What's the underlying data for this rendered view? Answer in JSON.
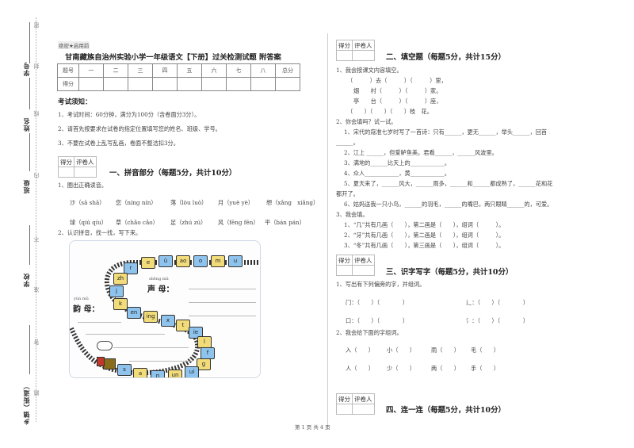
{
  "margin": {
    "labels": [
      "学号",
      "姓名",
      "班级",
      "学校",
      "乡镇（街道）"
    ],
    "seal_chars": [
      "密",
      "封",
      "线",
      "内",
      "不",
      "准",
      "答",
      "题"
    ]
  },
  "header": {
    "secret_tag": "绝密★启用前",
    "title": "甘南藏族自治州实验小学一年级语文【下册】过关检测试题 附答案",
    "score_table": {
      "row1": [
        "题号",
        "一",
        "二",
        "三",
        "四",
        "五",
        "六",
        "七",
        "八",
        "总分"
      ],
      "row2_label": "得分"
    }
  },
  "notice": {
    "heading": "考试须知：",
    "items": [
      "1、考试时间：60分钟，满分为100分（含卷面分3分）。",
      "2、请首先按要求在试卷的指定位置填写您的姓名、班级、学号。",
      "3、不要在试卷上乱写乱画，卷面不整洁扣3分。"
    ]
  },
  "grader": {
    "score": "得分",
    "grader": "评卷人"
  },
  "section1": {
    "title": "一、拼音部分（每题5分，共计10分）",
    "q1": "1、圈出正确读音。",
    "row1": [
      "沙（sā shā）",
      "您（níng nín）",
      "落（lòu luò）",
      "月（yuè yè）",
      "想（xǎng　xiǎng）"
    ],
    "row2": [
      "球（qiú qíu）",
      "草（chǎo cǎo）",
      "足（zhú zú）",
      "风（fēng fēn）",
      "平（bán pán）"
    ],
    "q2": "2、认识拼音，找一找，写下来。",
    "image": {
      "shengmu_pinyin": "shēng mǔ",
      "shengmu": "声 母：",
      "yunmu_pinyin": "yùn mǔ",
      "yunmu": "韵 母：",
      "cars": [
        "u",
        "m",
        "o",
        "ao",
        "ü",
        "e",
        "r",
        "zh",
        "j",
        "k",
        "en",
        "ing",
        "x",
        "t",
        "ie",
        "l",
        "f",
        "g",
        "ui",
        "un",
        "n",
        "a",
        "s"
      ]
    }
  },
  "section2": {
    "title": "二、填空题（每题5分，共计15分）",
    "q1": "1、我会按课文内容填空。",
    "q1_lines": [
      "（　　　）去（　　　）（　　　）里，",
      "烟　　村（　　　）（　　　）家。",
      "亭　　台（　　　）（　　　）座，",
      "（　　）（　　）（　　）枝　花。"
    ],
    "q2": "2、你会填吗？试一试。",
    "q2_lines": [
      "1、宋代的寇准七岁时写了一首诗：只有______，更无______，举头______，回首",
      "______。",
      "2、江上 ______，但爱鲈鱼美。君看______，______风波里。",
      "3、满地的______比天上的____________。",
      "4、众人____________，黄____________。",
      "5、夏天来了，______风大，______雨多，______和______都成熟了，______花和花",
      "都开了。",
      "6、姑妈送我一只小鸟，______的羽毛，______的嘴巴，两只眼睛______的，可爱。"
    ],
    "q3": "3、我会填。",
    "q3_lines": [
      "1、“几”共有几画（　　），第二画是（　　），组词（　　　）。",
      "2、“牙”共有几画（　　），第二画是（　　），组词（　　　）。",
      "3、“冬”共有几画（　　），第三画是（　　），组词（　　　）。"
    ]
  },
  "section3": {
    "title": "三、识字写字（每题5分，共计10分）",
    "q1": "1、写出有下列偏旁的字，并组词。",
    "q1_rows": [
      [
        "门：（　　）（　　　　）",
        "辶：（　　）（　　　　）"
      ],
      [
        "口：（　　）（　　　　）",
        "氵：（　　）（　　　　）"
      ]
    ],
    "q2": "2、我会给下面的字组词。",
    "q2_rows": [
      [
        "入（　　）",
        "小（　　）",
        "雨（　　）",
        "毛（　　）"
      ],
      [
        "人（　　）",
        "少（　　）",
        "两（　　）",
        "手（　　）"
      ]
    ]
  },
  "section4": {
    "title": "四、连一连（每题5分，共计10分）"
  },
  "footer": {
    "page": "第 1 页 共 4 页"
  }
}
